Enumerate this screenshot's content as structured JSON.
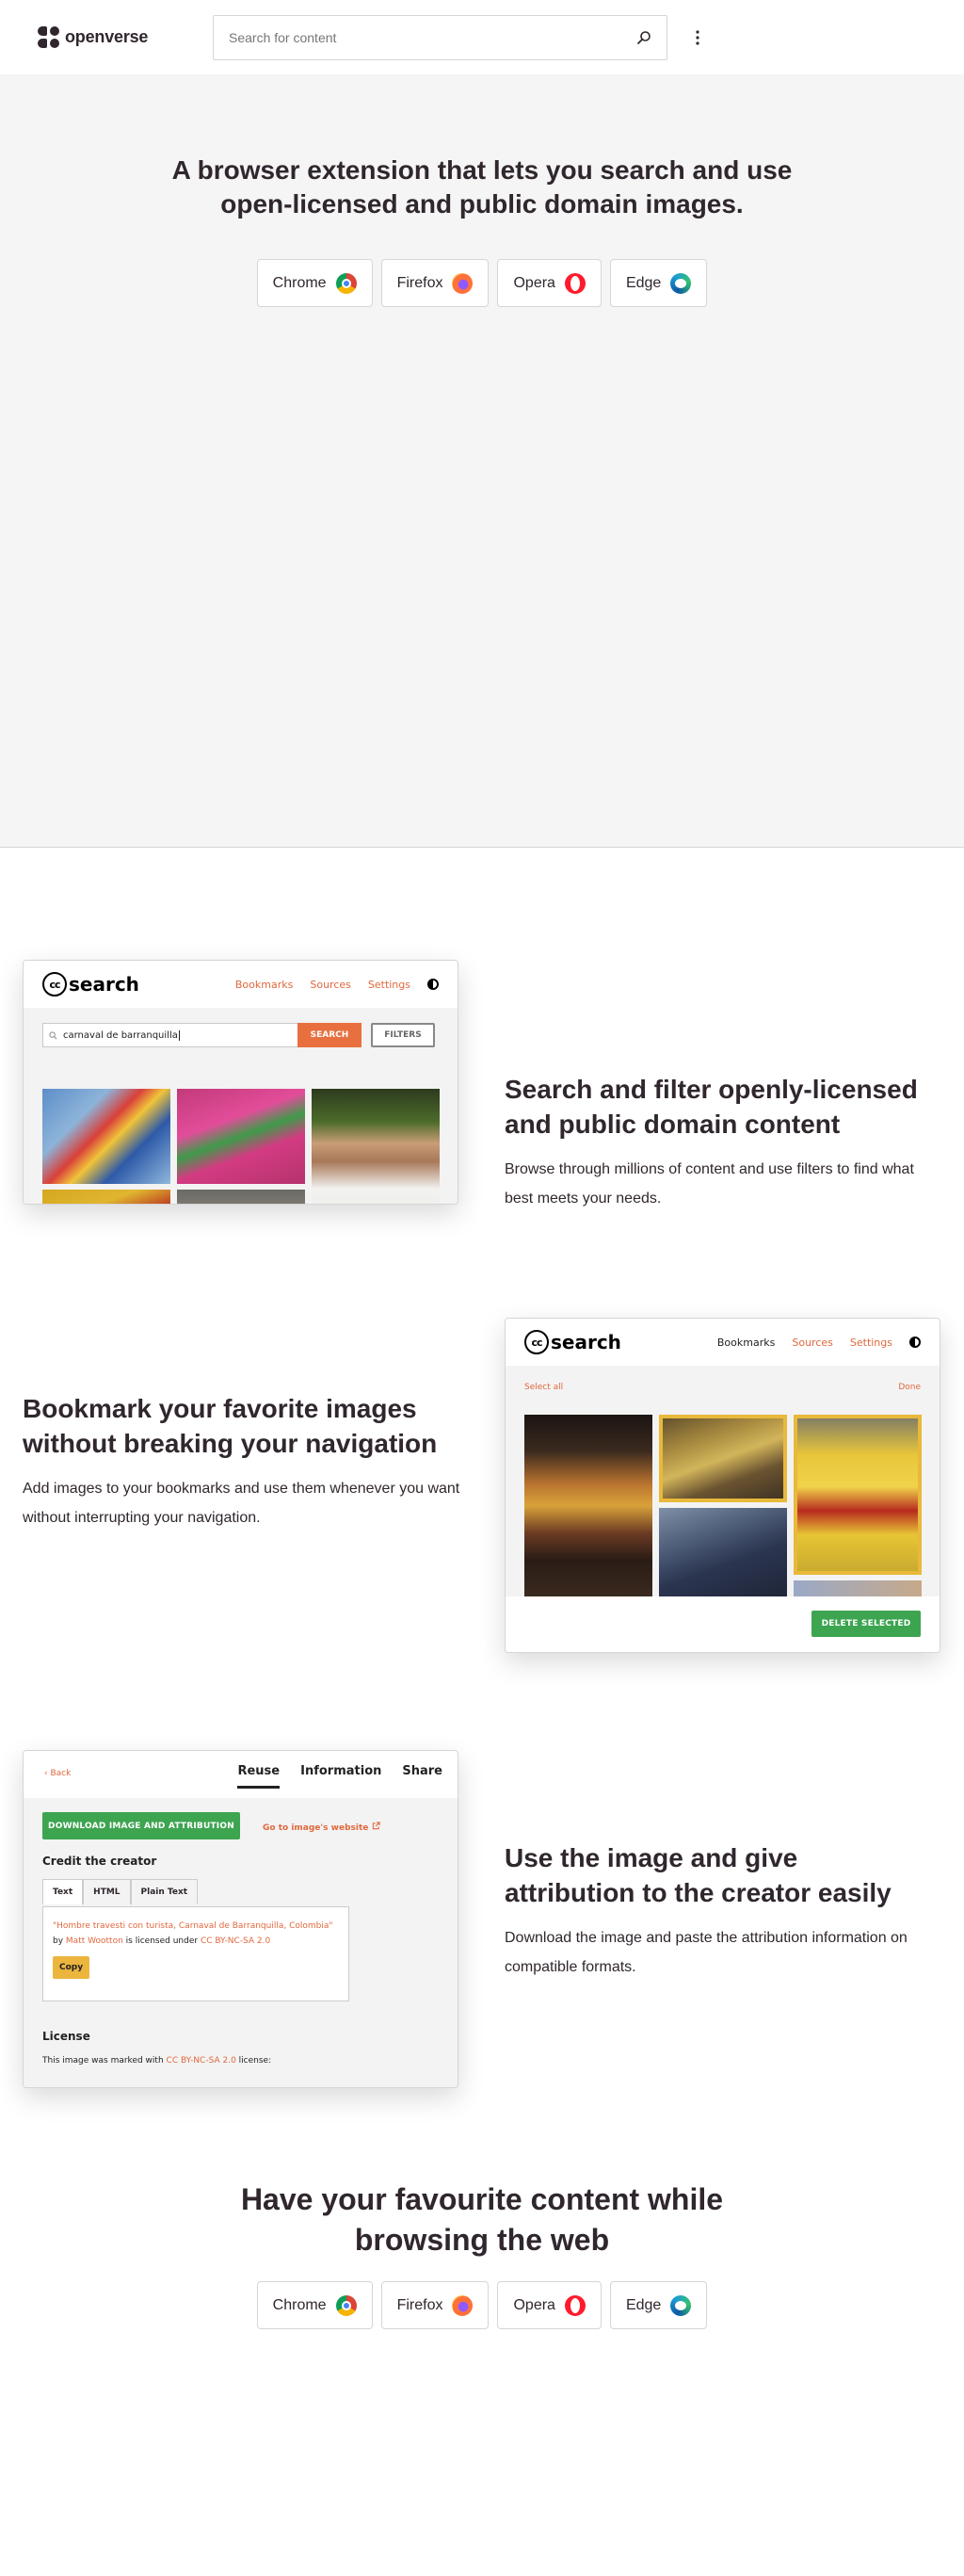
{
  "header": {
    "logo_text": "openverse",
    "search_placeholder": "Search for content"
  },
  "hero": {
    "title": "A browser extension that lets you search and use open-licensed and public domain images.",
    "browsers": [
      {
        "label": "Chrome",
        "icon": "chrome-icon"
      },
      {
        "label": "Firefox",
        "icon": "firefox-icon"
      },
      {
        "label": "Opera",
        "icon": "opera-icon"
      },
      {
        "label": "Edge",
        "icon": "edge-icon"
      }
    ]
  },
  "features": {
    "search": {
      "title": "Search and filter openly-licensed and public domain content",
      "description": "Browse through millions of content and use filters to find what best meets your needs.",
      "mock": {
        "logo": "search",
        "nav": [
          "Bookmarks",
          "Sources",
          "Settings"
        ],
        "query": "carnaval de barranquilla",
        "search_button": "SEARCH",
        "filters_button": "FILTERS"
      }
    },
    "bookmark": {
      "title": "Bookmark your favorite images without breaking your navigation",
      "description": "Add images to your bookmarks and use them whenever you want without interrupting your navigation.",
      "mock": {
        "logo": "search",
        "nav": [
          "Bookmarks",
          "Sources",
          "Settings"
        ],
        "select_all": "Select all",
        "done": "Done",
        "delete_button": "DELETE SELECTED"
      }
    },
    "attribution": {
      "title": "Use the image and give attribution to the creator easily",
      "description": "Download the image and paste the attribution information on compatible formats.",
      "mock": {
        "back": "Back",
        "tabs": [
          "Reuse",
          "Information",
          "Share"
        ],
        "download_button": "DOWNLOAD IMAGE AND ATTRIBUTION",
        "website_link": "Go to image's website",
        "credit_heading": "Credit the creator",
        "text_tabs": [
          "Text",
          "HTML",
          "Plain Text"
        ],
        "attr_title": "\"Hombre travesti con turista, Carnaval de Barranquilla, Colombia\"",
        "attr_by": "by",
        "attr_author": "Matt Wootton",
        "attr_licensed": "is licensed under",
        "attr_license": "CC BY-NC-SA 2.0",
        "copy_button": "Copy",
        "license_heading": "License",
        "license_text": "This image was marked with",
        "license_name": "CC BY-NC-SA 2.0",
        "license_suffix": "license:"
      }
    }
  },
  "footer_cta": {
    "title": "Have your favourite content while browsing the web",
    "browsers": [
      {
        "label": "Chrome",
        "icon": "chrome-icon"
      },
      {
        "label": "Firefox",
        "icon": "firefox-icon"
      },
      {
        "label": "Opera",
        "icon": "opera-icon"
      },
      {
        "label": "Edge",
        "icon": "edge-icon"
      }
    ]
  },
  "colors": {
    "accent_orange": "#e0683e",
    "green": "#3da450",
    "select_yellow": "#e8b93a",
    "text_dark": "#30272e"
  }
}
